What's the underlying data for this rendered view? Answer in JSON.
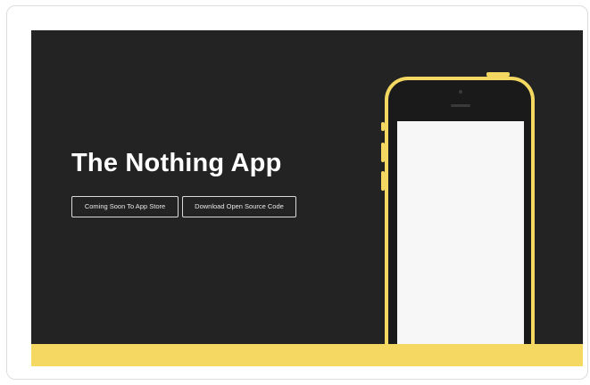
{
  "hero": {
    "title": "The Nothing App",
    "buttons": {
      "store_label": "Coming Soon To App Store",
      "code_label": "Download Open Source Code"
    }
  },
  "colors": {
    "background": "#232323",
    "accent": "#f4d862",
    "text": "#ffffff",
    "screen": "#f7f7f7"
  },
  "icons": {
    "phone": "phone-outline-icon"
  }
}
